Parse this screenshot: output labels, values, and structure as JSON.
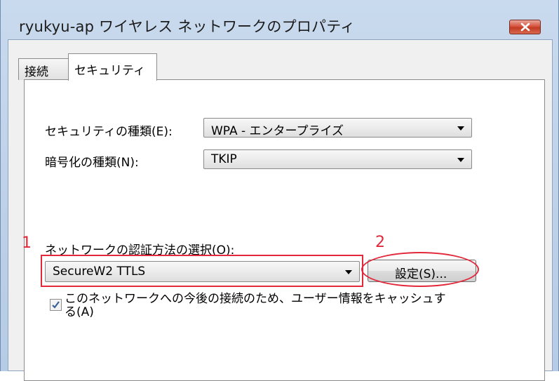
{
  "window": {
    "title": "ryukyu-ap ワイヤレス ネットワークのプロパティ"
  },
  "tabs": [
    {
      "label": "接続"
    },
    {
      "label": "セキュリティ"
    }
  ],
  "security": {
    "type_label": "セキュリティの種類(E):",
    "type_value": "WPA - エンタープライズ",
    "encryption_label": "暗号化の種類(N):",
    "encryption_value": "TKIP"
  },
  "auth": {
    "label": "ネットワークの認証方法の選択(O):",
    "value": "SecureW2 TTLS",
    "settings_button": "設定(S)...",
    "remember_checkbox_label": "このネットワークへの今後の接続のため、ユーザー情報をキャッシュする(A)",
    "remember_checked": true
  },
  "annotations": {
    "marker_1": "1",
    "marker_2": "2",
    "highlight_color": "#e2283a"
  }
}
